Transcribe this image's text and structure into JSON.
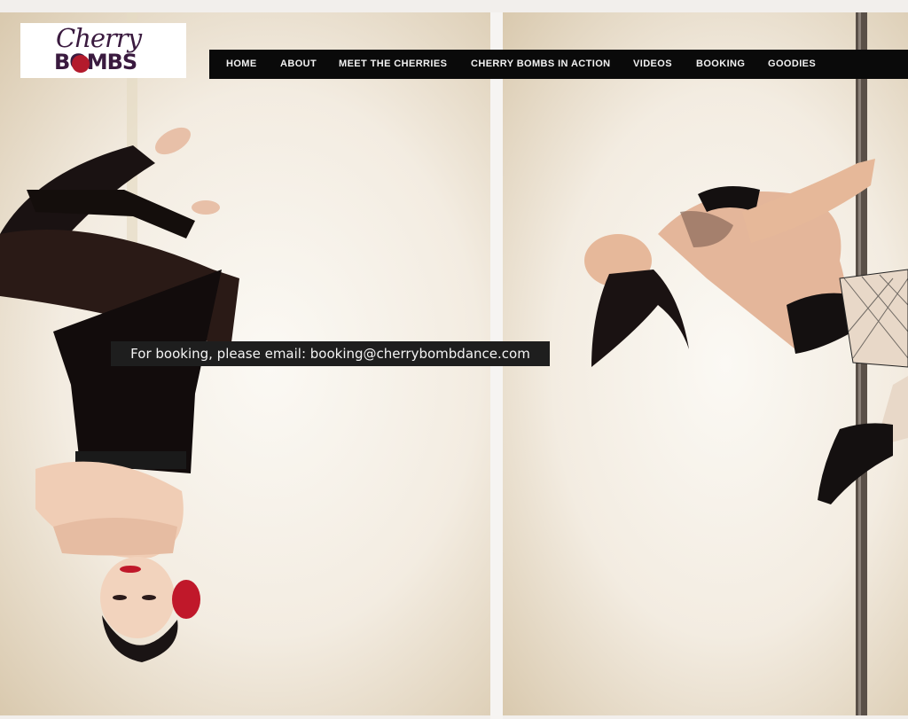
{
  "logo": {
    "script_text": "Cherry",
    "bold_text": "BOMBS"
  },
  "nav": {
    "items": [
      {
        "label": "HOME"
      },
      {
        "label": "ABOUT"
      },
      {
        "label": "MEET THE CHERRIES"
      },
      {
        "label": "CHERRY BOMBS IN ACTION"
      },
      {
        "label": "VIDEOS"
      },
      {
        "label": "BOOKING"
      },
      {
        "label": "GOODIES"
      }
    ]
  },
  "banner": {
    "text": "For booking, please email: booking@cherrybombdance.com"
  },
  "colors": {
    "nav_background": "#0a0a0a",
    "logo_color": "#3a1a3f",
    "cherry_red": "#b31a2c",
    "banner_background": "#1e1e1e"
  }
}
